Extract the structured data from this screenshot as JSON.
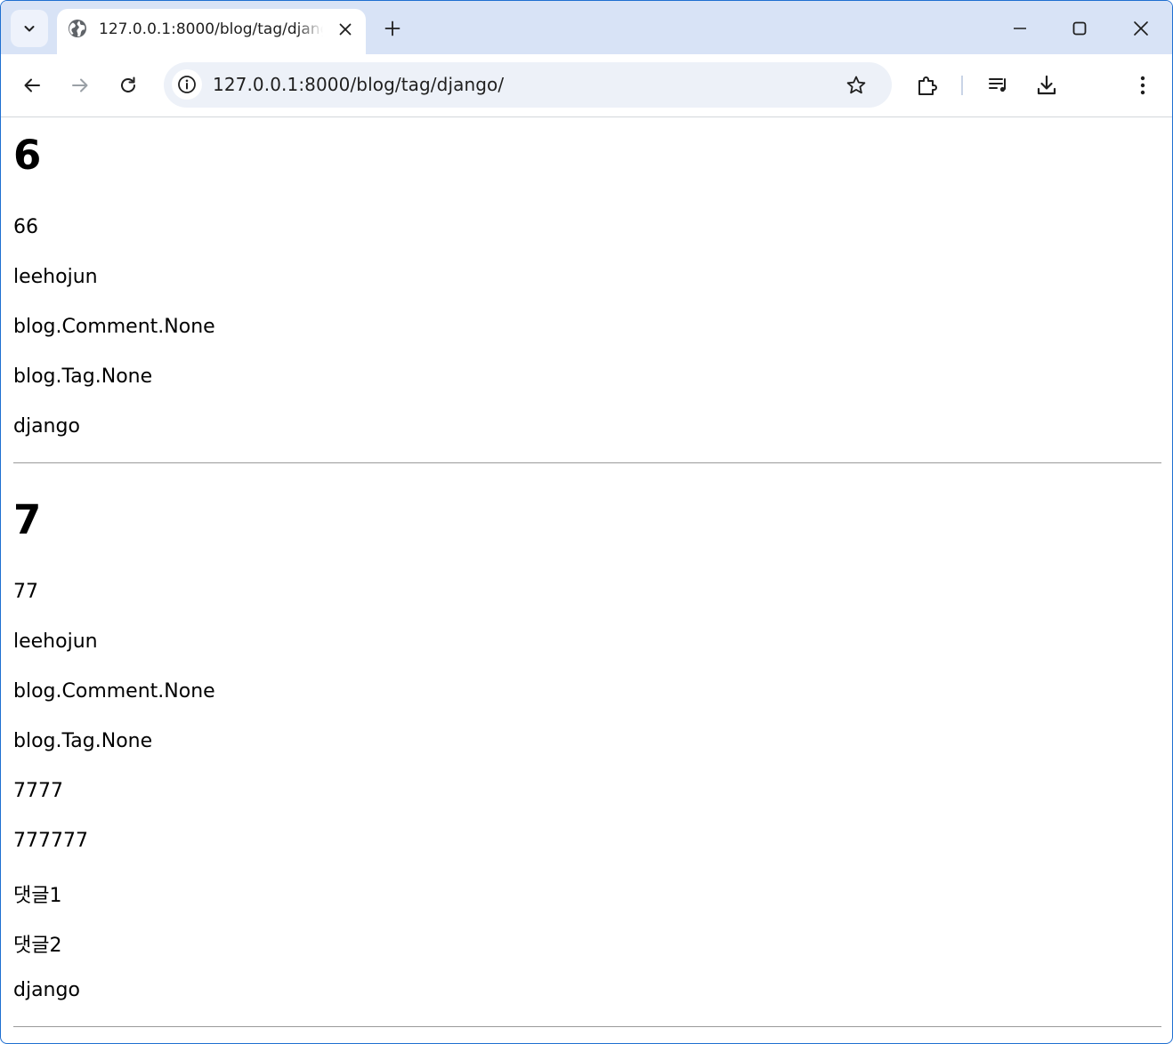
{
  "browser": {
    "tab": {
      "title": "127.0.0.1:8000/blog/tag/django/"
    },
    "address_bar": {
      "url": "127.0.0.1:8000/blog/tag/django/"
    },
    "icons": {
      "tab_search": "chevron-down-icon",
      "favicon": "globe-icon",
      "tab_close": "close-icon",
      "new_tab": "plus-icon",
      "minimize": "minimize-icon",
      "maximize": "maximize-icon",
      "close_window": "close-icon",
      "back": "arrow-left-icon",
      "forward": "arrow-right-icon",
      "reload": "reload-icon",
      "site_info": "info-icon",
      "bookmark": "star-icon",
      "extensions": "puzzle-icon",
      "media": "playlist-icon",
      "downloads": "download-icon",
      "menu": "kebab-menu-icon"
    },
    "colors": {
      "tab_strip": "#d8e3f6",
      "omnibox": "#edf1f8",
      "window_border": "#1f6fd1"
    }
  },
  "posts": [
    {
      "title": "6",
      "lines": [
        "66",
        "leehojun",
        "blog.Comment.None",
        "blog.Tag.None",
        "django"
      ]
    },
    {
      "title": "7",
      "lines": [
        "77",
        "leehojun",
        "blog.Comment.None",
        "blog.Tag.None",
        "7777",
        "777777",
        "댓글1",
        "댓글2",
        "django"
      ]
    }
  ]
}
